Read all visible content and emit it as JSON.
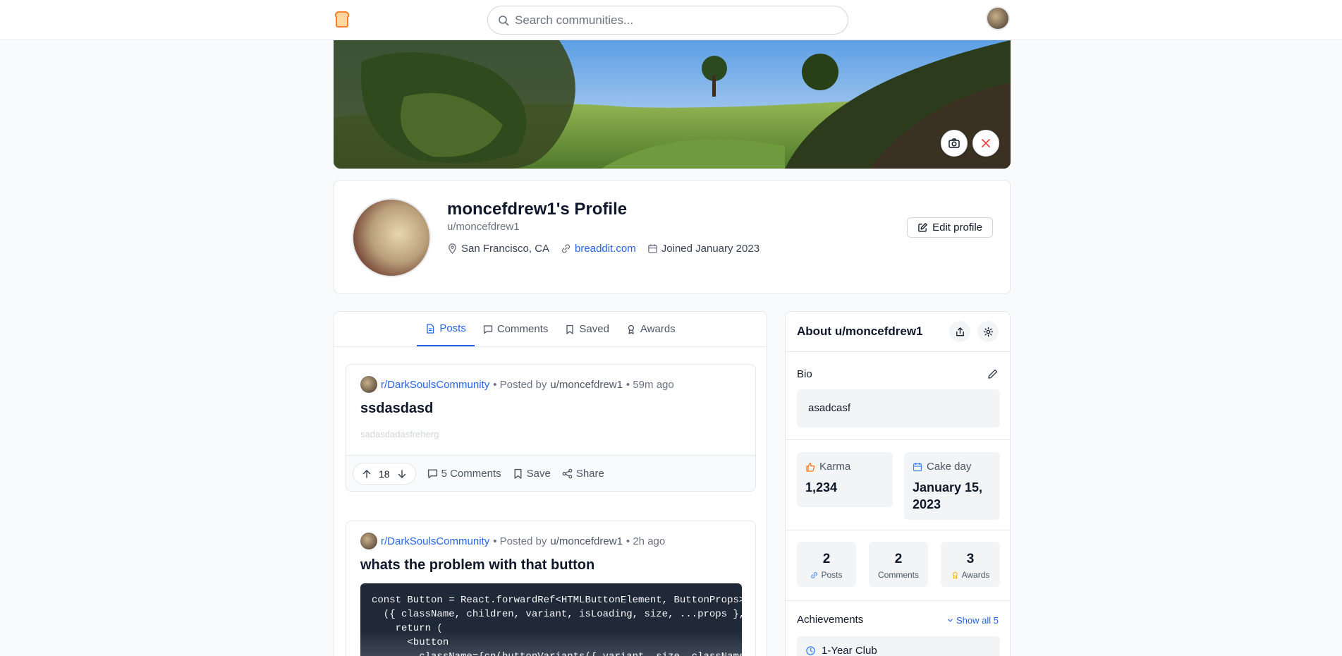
{
  "header": {
    "search_placeholder": "Search communities..."
  },
  "profile": {
    "title": "moncefdrew1's Profile",
    "handle": "u/moncefdrew1",
    "location": "San Francisco, CA",
    "website": "breaddit.com",
    "joined": "Joined January 2023",
    "edit_label": "Edit profile"
  },
  "tabs": [
    {
      "label": "Posts",
      "active": true
    },
    {
      "label": "Comments",
      "active": false
    },
    {
      "label": "Saved",
      "active": false
    },
    {
      "label": "Awards",
      "active": false
    }
  ],
  "posts": [
    {
      "subreddit": "r/DarkSoulsCommunity",
      "posted_by_prefix": "• Posted by",
      "author": "u/moncefdrew1",
      "time": "• 59m ago",
      "title": "ssdasdasd",
      "body": "sadasdadasfreherg",
      "votes": "18",
      "comments_label": "5 Comments",
      "save_label": "Save",
      "share_label": "Share"
    },
    {
      "subreddit": "r/DarkSoulsCommunity",
      "posted_by_prefix": "• Posted by",
      "author": "u/moncefdrew1",
      "time": "• 2h ago",
      "title": "whats the problem with that button",
      "code": "const Button = React.forwardRef<HTMLButtonElement, ButtonProps>(\n  ({ className, children, variant, isLoading, size, ...props },\n    return (\n      <button\n        className={cn(buttonVariants({ variant, size, className"
    }
  ],
  "sidebar": {
    "title": "About u/moncefdrew1",
    "bio_label": "Bio",
    "bio_text": "asadcasf",
    "karma_label": "Karma",
    "karma_value": "1,234",
    "cake_label": "Cake day",
    "cake_value": "January 15, 2023",
    "stats": [
      {
        "num": "2",
        "label": "Posts"
      },
      {
        "num": "2",
        "label": "Comments"
      },
      {
        "num": "3",
        "label": "Awards"
      }
    ],
    "achievements_label": "Achievements",
    "show_all_label": "Show all 5",
    "achievement_first": "1-Year Club"
  },
  "colors": {
    "accent": "#2563eb",
    "danger": "#ef4444",
    "karma": "#f97316",
    "award": "#eab308"
  }
}
